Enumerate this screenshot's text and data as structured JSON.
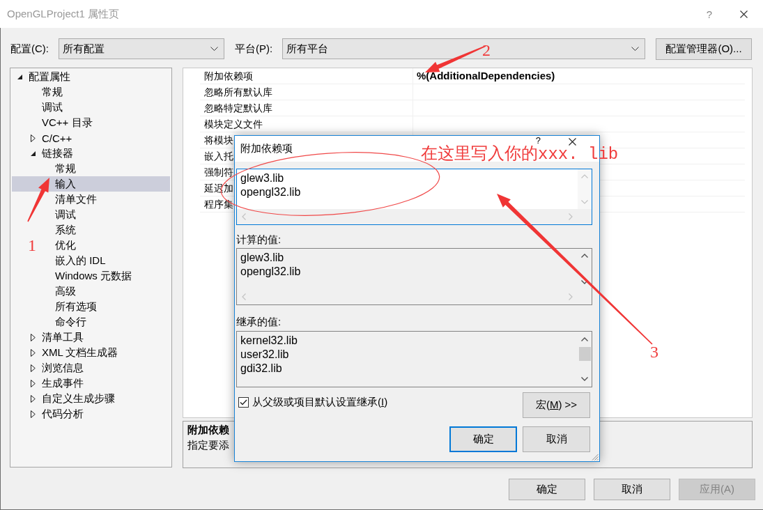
{
  "window": {
    "title": "OpenGLProject1 属性页",
    "help": "?"
  },
  "config_bar": {
    "configuration": {
      "label": "配置(C):",
      "value": "所有配置"
    },
    "platform": {
      "label": "平台(P):",
      "value": "所有平台"
    },
    "manager_button": "配置管理器(O)..."
  },
  "tree": [
    {
      "label": "配置属性",
      "kind": "group",
      "expanded": true,
      "selected": false,
      "children": [
        {
          "label": "常规",
          "kind": "item",
          "selected": false
        },
        {
          "label": "调试",
          "kind": "item",
          "selected": false
        },
        {
          "label": "VC++ 目录",
          "kind": "item",
          "selected": false
        },
        {
          "label": "C/C++",
          "kind": "group",
          "expanded": false,
          "selected": false
        },
        {
          "label": "链接器",
          "kind": "group",
          "expanded": true,
          "selected": false,
          "children": [
            {
              "label": "常规",
              "kind": "item",
              "selected": false
            },
            {
              "label": "输入",
              "kind": "item",
              "selected": true
            },
            {
              "label": "清单文件",
              "kind": "item",
              "selected": false
            },
            {
              "label": "调试",
              "kind": "item",
              "selected": false
            },
            {
              "label": "系统",
              "kind": "item",
              "selected": false
            },
            {
              "label": "优化",
              "kind": "item",
              "selected": false
            },
            {
              "label": "嵌入的 IDL",
              "kind": "item",
              "selected": false
            },
            {
              "label": "Windows 元数据",
              "kind": "item",
              "selected": false
            },
            {
              "label": "高级",
              "kind": "item",
              "selected": false
            },
            {
              "label": "所有选项",
              "kind": "item",
              "selected": false
            },
            {
              "label": "命令行",
              "kind": "item",
              "selected": false
            }
          ]
        },
        {
          "label": "清单工具",
          "kind": "group",
          "expanded": false,
          "selected": false
        },
        {
          "label": "XML 文档生成器",
          "kind": "group",
          "expanded": false,
          "selected": false
        },
        {
          "label": "浏览信息",
          "kind": "group",
          "expanded": false,
          "selected": false
        },
        {
          "label": "生成事件",
          "kind": "group",
          "expanded": false,
          "selected": false
        },
        {
          "label": "自定义生成步骤",
          "kind": "group",
          "expanded": false,
          "selected": false
        },
        {
          "label": "代码分析",
          "kind": "group",
          "expanded": false,
          "selected": false
        }
      ]
    }
  ],
  "properties": [
    {
      "name": "附加依赖项",
      "value": "%(AdditionalDependencies)"
    },
    {
      "name": "忽略所有默认库"
    },
    {
      "name": "忽略特定默认库"
    },
    {
      "name": "模块定义文件"
    },
    {
      "name": "将模块"
    },
    {
      "name": "嵌入托"
    },
    {
      "name": "强制符"
    },
    {
      "name": "延迟加"
    },
    {
      "name": "程序集"
    }
  ],
  "description": {
    "title": "附加依赖",
    "text": "指定要添"
  },
  "dialog": {
    "title": "附加依赖项",
    "help": "?",
    "edit_lines": [
      "glew3.lib",
      "opengl32.lib"
    ],
    "computed": {
      "label": "计算的值:",
      "lines": [
        "glew3.lib",
        "opengl32.lib"
      ]
    },
    "inherited": {
      "label": "继承的值:",
      "lines": [
        "kernel32.lib",
        "user32.lib",
        "gdi32.lib"
      ]
    },
    "inherit_checkbox": {
      "label": {
        "pre": "从父级或项目默认设置继承(",
        "key": "I",
        "post": ")"
      },
      "checked": true
    },
    "macros_button": {
      "pre": "宏(",
      "key": "M",
      "post": ") >>"
    },
    "buttons": [
      {
        "label": "确定",
        "default": true
      },
      {
        "label": "取消",
        "default": false
      }
    ]
  },
  "buttons": [
    {
      "label": "确定",
      "disabled": false
    },
    {
      "label": "取消",
      "disabled": false
    },
    {
      "label": "应用(A)",
      "disabled": true
    }
  ],
  "annotations": {
    "note": "在这里写入你的xxx. lib",
    "markers": [
      "1",
      "2",
      "3"
    ]
  }
}
